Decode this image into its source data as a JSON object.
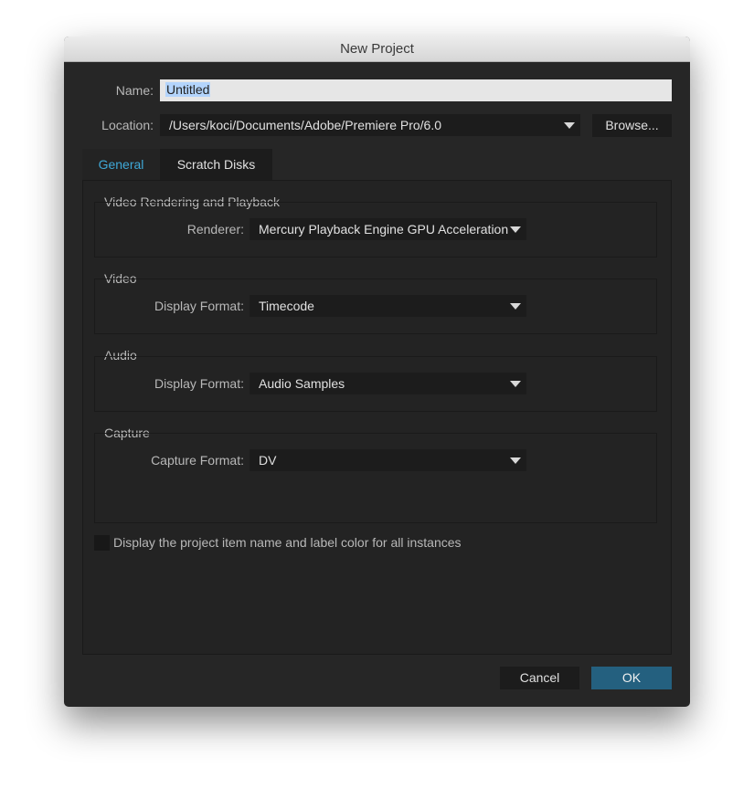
{
  "window": {
    "title": "New Project"
  },
  "name": {
    "label": "Name:",
    "value": "Untitled"
  },
  "location": {
    "label": "Location:",
    "value": "/Users/koci/Documents/Adobe/Premiere Pro/6.0",
    "browse": "Browse..."
  },
  "tabs": [
    {
      "label": "General",
      "active": true
    },
    {
      "label": "Scratch Disks",
      "active": false
    }
  ],
  "groups": {
    "rendering": {
      "title": "Video Rendering and Playback",
      "label": "Renderer:",
      "value": "Mercury Playback Engine GPU Acceleration"
    },
    "video": {
      "title": "Video",
      "label": "Display Format:",
      "value": "Timecode"
    },
    "audio": {
      "title": "Audio",
      "label": "Display Format:",
      "value": "Audio Samples"
    },
    "capture": {
      "title": "Capture",
      "label": "Capture Format:",
      "value": "DV"
    }
  },
  "checkbox": {
    "label": "Display the project item name and label color for all instances",
    "checked": false
  },
  "buttons": {
    "cancel": "Cancel",
    "ok": "OK"
  },
  "colors": {
    "accent": "#3fa9d8",
    "ok": "#24607f"
  }
}
